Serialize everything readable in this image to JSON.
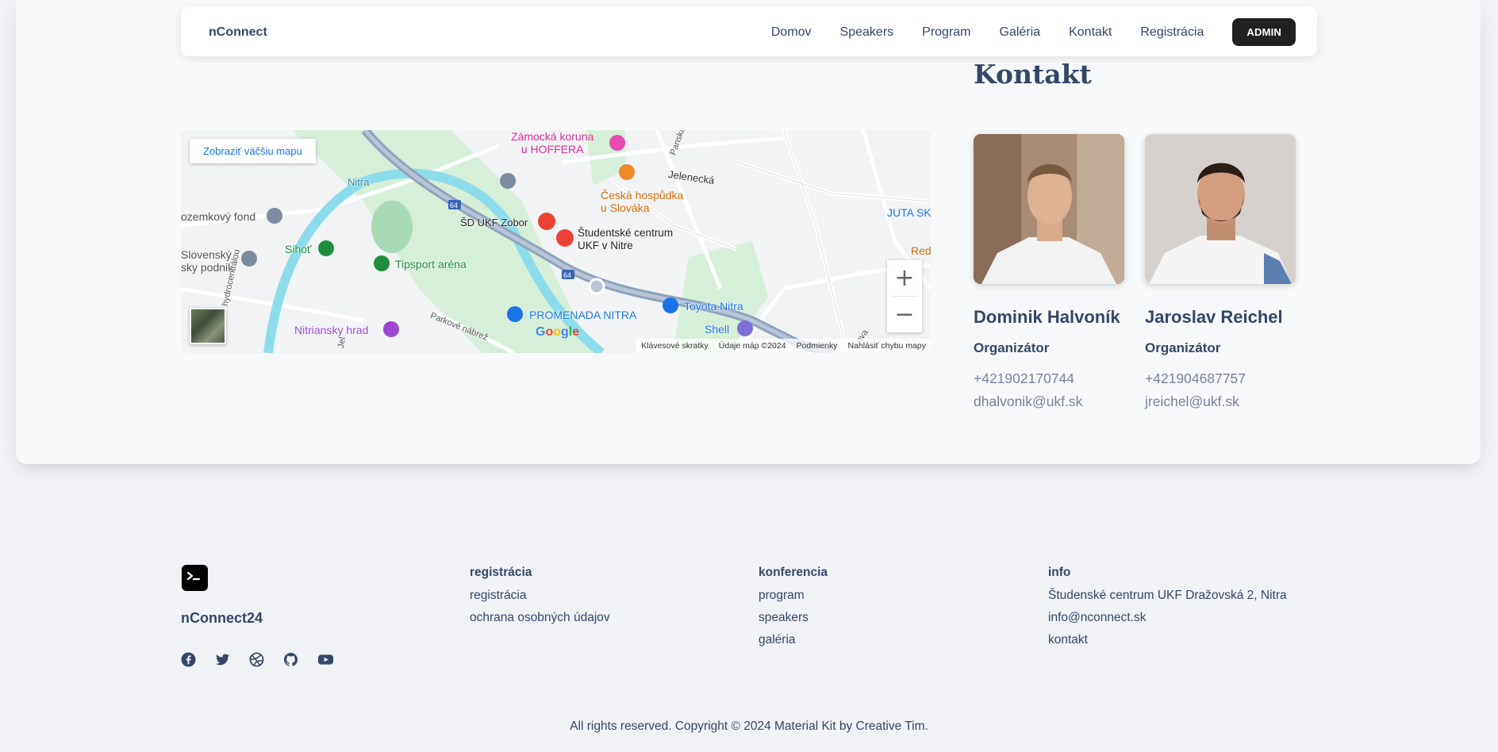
{
  "navbar": {
    "brand": "nConnect",
    "links": [
      "Domov",
      "Speakers",
      "Program",
      "Galéria",
      "Kontakt",
      "Registrácia"
    ],
    "admin": "ADMIN"
  },
  "map": {
    "larger_map": "Zobraziť väčšiu mapu",
    "labels": {
      "zamocka": "Zámocká koruna\nu HOFFERA",
      "panska": "Panská",
      "jelenecka": "Jelenecká",
      "ceska": "Česká hospůdka\nu Slováka",
      "nitra": "Nitra",
      "pozemkovy": "ozemkový fond",
      "juta": "JUTA SK",
      "sd_ukf": "ŠD UKF Zobor",
      "studentske": "Študentské centrum\nUKF v Nitre",
      "slovensky": "Slovenský\nsky podnik",
      "sihot": "Sihoť",
      "tipsport": "Tipsport aréna",
      "red": "Red",
      "road64a": "64",
      "road64b": "64",
      "hydrocentral": "hydrocentrálou",
      "promenada": "PROMENADA NITRA",
      "toyota": "Toyota Nitra",
      "nitriansky": "Nitriansky hrad",
      "parkove": "Parkové nábrež",
      "shell": "Shell",
      "jel2": "Jel",
      "nova": "ova"
    },
    "google": "Google",
    "attribution": [
      "Klávesové skratky",
      "Údaje máp ©2024",
      "Podmienky",
      "Nahlásiť chybu mapy"
    ],
    "zoom_in": "+",
    "zoom_out": "−"
  },
  "contact": {
    "title": "Kontakt",
    "people": [
      {
        "name": "Dominik Halvoník",
        "role": "Organizátor",
        "phone": "+421902170744",
        "email": "dhalvonik@ukf.sk"
      },
      {
        "name": "Jaroslav Reichel",
        "role": "Organizátor",
        "phone": "+421904687757",
        "email": "jreichel@ukf.sk"
      }
    ]
  },
  "footer": {
    "brand": "nConnect24",
    "socials": [
      "facebook-icon",
      "twitter-icon",
      "dribbble-icon",
      "github-icon",
      "youtube-icon"
    ],
    "columns": [
      {
        "title": "registrácia",
        "items": [
          "registrácia",
          "ochrana osobných údajov"
        ]
      },
      {
        "title": "konferencia",
        "items": [
          "program",
          "speakers",
          "galéria"
        ]
      },
      {
        "title": "info",
        "items": [
          "Študenské centrum UKF Dražovská 2, Nitra",
          "info@nconnect.sk",
          "kontakt"
        ]
      }
    ],
    "copyright": "All rights reserved. Copyright © 2024 Material Kit by Creative Tim."
  }
}
